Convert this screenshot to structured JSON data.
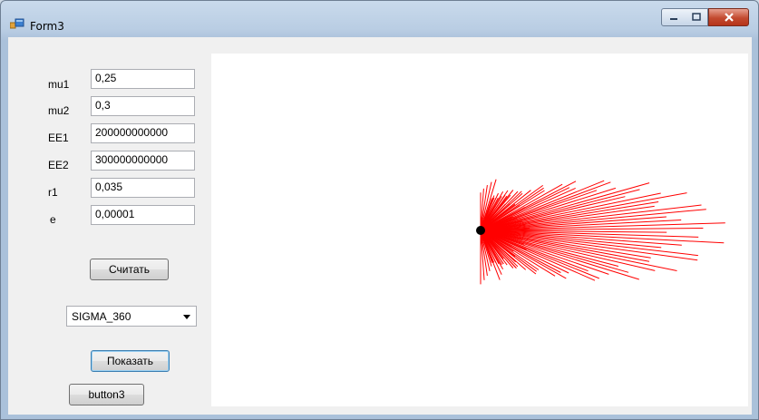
{
  "window": {
    "title": "Form3",
    "icon": "winforms-app-icon",
    "controls": [
      "minimize-icon",
      "maximize-icon",
      "close-icon"
    ]
  },
  "fields": [
    {
      "label": "mu1",
      "value": "0,25"
    },
    {
      "label": "mu2",
      "value": "0,3"
    },
    {
      "label": "EE1",
      "value": "200000000000"
    },
    {
      "label": "EE2",
      "value": "300000000000"
    },
    {
      "label": "r1",
      "value": "0,035"
    },
    {
      "label": "e",
      "value": "0,00001"
    }
  ],
  "buttons": {
    "calculate": "Считать",
    "show": "Показать",
    "button3": "button3"
  },
  "select": {
    "selected": "SIGMA_360"
  },
  "plot": {
    "line_color": "#ff0000",
    "point_color": "#000000",
    "background": "#ffffff"
  }
}
